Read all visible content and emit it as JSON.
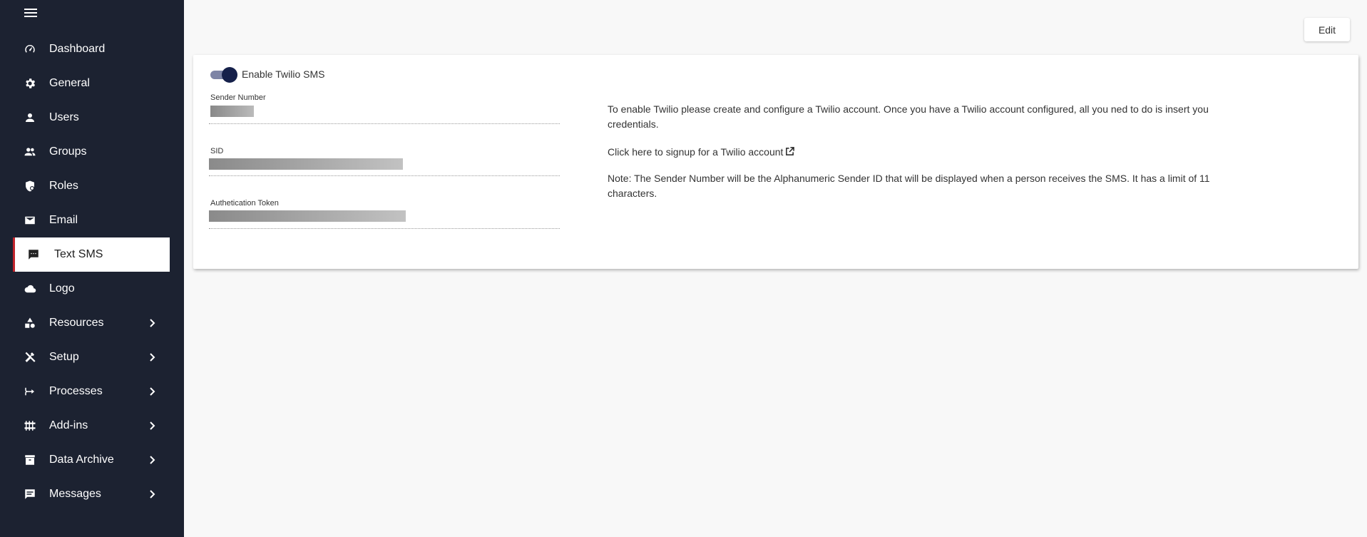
{
  "sidebar": {
    "items": [
      {
        "label": "Dashboard",
        "icon": "dashboard-icon",
        "has_submenu": false
      },
      {
        "label": "General",
        "icon": "gear-icon",
        "has_submenu": false
      },
      {
        "label": "Users",
        "icon": "user-icon",
        "has_submenu": false
      },
      {
        "label": "Groups",
        "icon": "people-icon",
        "has_submenu": false
      },
      {
        "label": "Roles",
        "icon": "shield-icon",
        "has_submenu": false
      },
      {
        "label": "Email",
        "icon": "envelope-icon",
        "has_submenu": false
      },
      {
        "label": "Text SMS",
        "icon": "sms-icon",
        "has_submenu": false,
        "active": true
      },
      {
        "label": "Logo",
        "icon": "cloud-icon",
        "has_submenu": false
      },
      {
        "label": "Resources",
        "icon": "shapes-icon",
        "has_submenu": true
      },
      {
        "label": "Setup",
        "icon": "tools-icon",
        "has_submenu": true
      },
      {
        "label": "Processes",
        "icon": "merge-arrow-icon",
        "has_submenu": true
      },
      {
        "label": "Add-ins",
        "icon": "grid-icon",
        "has_submenu": true
      },
      {
        "label": "Data Archive",
        "icon": "archive-icon",
        "has_submenu": true
      },
      {
        "label": "Messages",
        "icon": "chat-icon",
        "has_submenu": true
      }
    ]
  },
  "toolbar": {
    "edit_label": "Edit"
  },
  "twilio": {
    "enable_label": "Enable Twilio SMS",
    "enabled": true,
    "fields": {
      "sender_number_label": "Sender Number",
      "sid_label": "SID",
      "auth_token_label": "Authetication Token"
    },
    "info": {
      "paragraph1": "To enable Twilio please create and configure a Twilio account. Once you have a Twilio account configured, all you ned to do is insert you credentials.",
      "signup_link": "Click here to signup for a Twilio account",
      "note": "Note: The Sender Number will be the Alphanumeric Sender ID that will be displayed when a person receives the SMS. It has a limit of 11 characters."
    }
  },
  "colors": {
    "sidebar_bg": "#1c2231",
    "active_indicator": "#c0232b",
    "toggle_thumb": "#15204a",
    "page_bg": "#f8f8f8"
  }
}
